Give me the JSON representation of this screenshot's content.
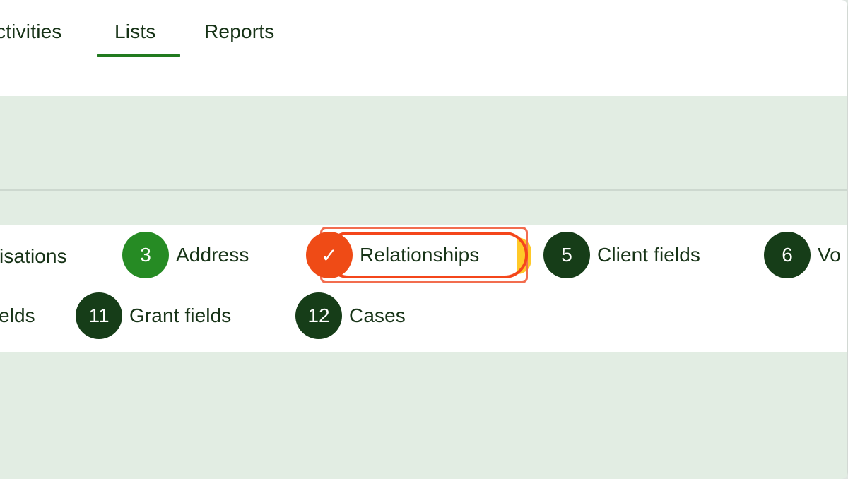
{
  "nav": {
    "tabs": [
      {
        "label": "ctivities"
      },
      {
        "label": "Lists"
      },
      {
        "label": "Reports"
      }
    ]
  },
  "stepper": {
    "row1": [
      {
        "label": "isations"
      },
      {
        "number": "3",
        "label": "Address"
      },
      {
        "number": "✓",
        "label": "Relationships"
      },
      {
        "number": "5",
        "label": "Client fields"
      },
      {
        "number": "6",
        "label": "Vo"
      }
    ],
    "row2": [
      {
        "label": "elds"
      },
      {
        "number": "11",
        "label": "Grant fields"
      },
      {
        "number": "12",
        "label": "Cases"
      }
    ]
  },
  "colors": {
    "active_tab_underline": "#217a1f",
    "completed_step": "#268b24",
    "current_step": "#ef4b16",
    "pending_step": "#163d18",
    "page_background": "#e2ede3"
  }
}
